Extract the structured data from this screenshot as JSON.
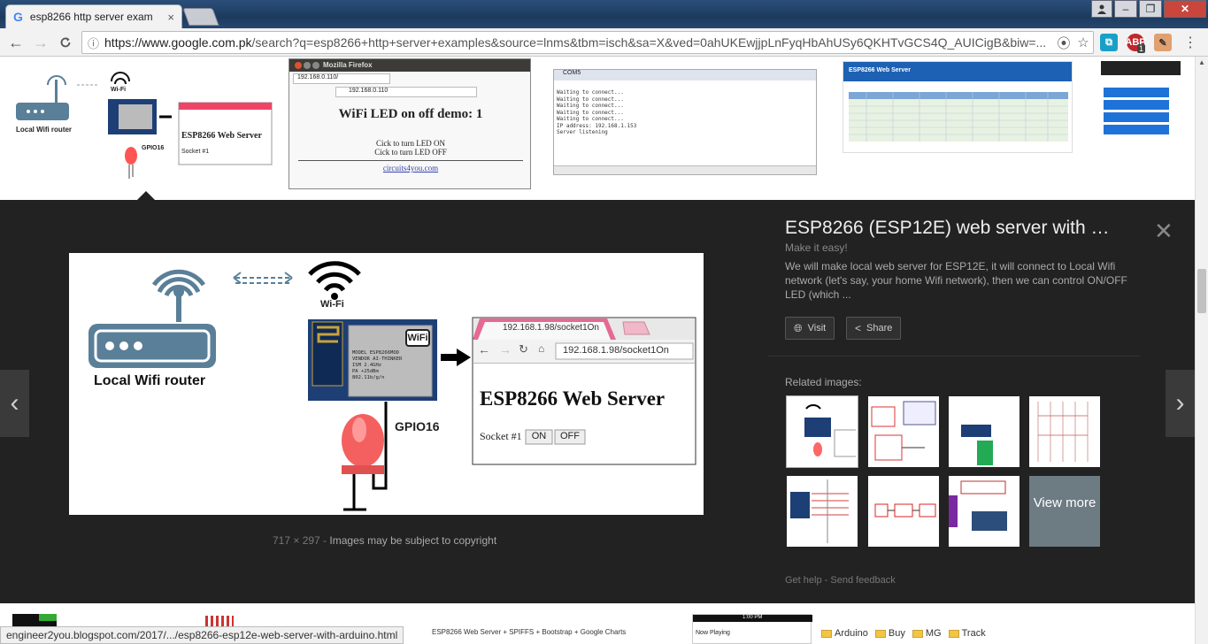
{
  "browser": {
    "tab_title": "esp8266 http server exam",
    "tab_close": "×",
    "url_host": "https://www.google.com.pk",
    "url_path": "/search?q=esp8266+http+server+examples&source=lnms&tbm=isch&sa=X&ved=0ahUKEwjjpLnFyqHbAhUSy6QKHTvGCS4Q_AUICigB&biw=...",
    "extension_badge": "1",
    "win_min": "–",
    "win_max": "❐",
    "win_close": "✕"
  },
  "top_strip": {
    "thumb1": {
      "router_label": "Local Wifi router",
      "wifi_label": "Wi-Fi",
      "gpio": "GPIO16",
      "server_title": "ESP8266 Web Server",
      "socket": "Socket #1"
    },
    "thumb2": {
      "window_title": "Mozilla Firefox",
      "tab": "192.168.0.110/",
      "url": "192.168.0.110",
      "heading": "WiFi LED on off demo: 1",
      "line1": "Cick to turn LED ON",
      "line2": "Cick to turn LED OFF",
      "footer": "circuits4you.com"
    },
    "thumb3": {
      "title": "COM5",
      "lines": [
        "Waiting to connect...",
        "Waiting to connect...",
        "Waiting to connect...",
        "Waiting to connect...",
        "Waiting to connect...",
        "IP address: 192.168.1.153",
        "Server listening"
      ]
    },
    "thumb4": {
      "title": "ESP8266 Web Server"
    }
  },
  "viewer": {
    "title": "ESP8266 (ESP12E) web server with …",
    "subtitle": "Make it easy!",
    "description": "We will make local web server for ESP12E, it will connect to Local Wifi network (let's say, your home Wifi network), then we can control ON/OFF LED (which  ...",
    "visit": "Visit",
    "share": "Share",
    "related_label": "Related images:",
    "view_more": "View more",
    "dimensions": "717 × 297",
    "separator": " - ",
    "copyright": "Images may be subject to copyright",
    "get_help": "Get help",
    "send_feedback": "Send feedback",
    "help_sep": " - "
  },
  "main_image": {
    "router_label": "Local Wifi router",
    "wifi_label": "Wi-Fi",
    "gpio_label": "GPIO16",
    "chip_model": "MODEL   ESP8266MOD",
    "chip_vendor": "VENDOR  AI-THINKER",
    "chip_ism": "ISM 2.4GHz",
    "chip_pa": "PA  +25dBm",
    "chip_std": "802.11b/g/n",
    "chip_wifi": "WiFi",
    "browser_tab": "192.168.1.98/socket1On",
    "browser_url": "192.168.1.98/socket1On",
    "page_heading": "ESP8266 Web Server",
    "socket_label": "Socket #1",
    "on_btn": "ON",
    "off_btn": "OFF"
  },
  "bottom": {
    "status_url": "engineer2you.blogspot.com/2017/.../esp8266-esp12e-web-server-with-arduino.html",
    "snippet": "ESP8266 Web Server + SPIFFS + Bootstrap + Google Charts",
    "phone_time": "1:00 PM",
    "phone_label": "Now Playing",
    "bookmarks": [
      "Arduino",
      "Buy",
      "MG",
      "Track"
    ]
  },
  "colors": {
    "panel_bg": "#222222",
    "accent_blue": "#1a73e8",
    "router_blue": "#5a7f98"
  }
}
